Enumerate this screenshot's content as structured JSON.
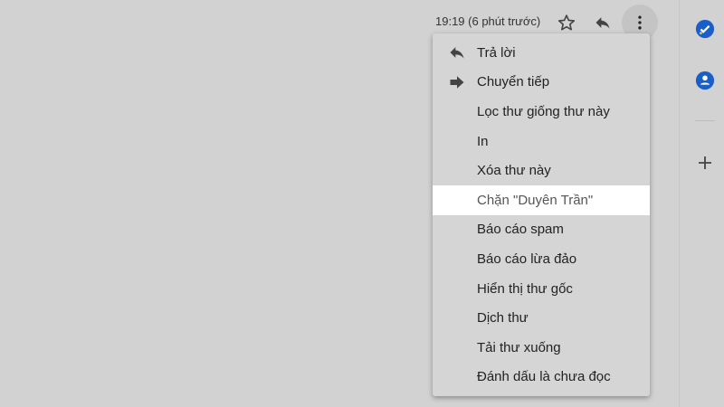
{
  "header": {
    "timestamp": "19:19 (6 phút trước)"
  },
  "menu": {
    "items": [
      {
        "label": "Trả lời",
        "icon": "reply-icon"
      },
      {
        "label": "Chuyển tiếp",
        "icon": "forward-icon"
      },
      {
        "label": "Lọc thư giống thư này"
      },
      {
        "label": "In"
      },
      {
        "label": "Xóa thư này"
      },
      {
        "label": "Chặn \"Duyên Trần\"",
        "highlighted": true
      },
      {
        "label": "Báo cáo spam"
      },
      {
        "label": "Báo cáo lừa đảo"
      },
      {
        "label": "Hiển thị thư gốc"
      },
      {
        "label": "Dịch thư"
      },
      {
        "label": "Tải thư xuống"
      },
      {
        "label": "Đánh dấu là chưa đọc"
      }
    ]
  },
  "colors": {
    "accent": "#1a5fc8",
    "highlight": "#ffffff"
  }
}
